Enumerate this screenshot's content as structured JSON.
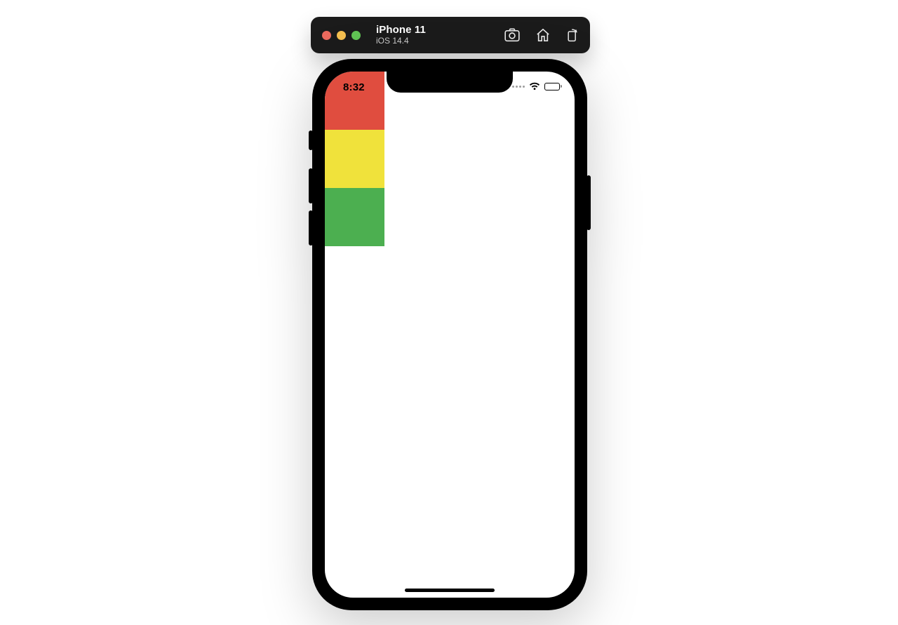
{
  "control_bar": {
    "device_name": "iPhone 11",
    "os_version": "iOS 14.4"
  },
  "status_bar": {
    "time": "8:32"
  },
  "app": {
    "blocks": [
      {
        "color": "#e04d3f"
      },
      {
        "color": "#f0e23b"
      },
      {
        "color": "#4caf50"
      }
    ]
  }
}
